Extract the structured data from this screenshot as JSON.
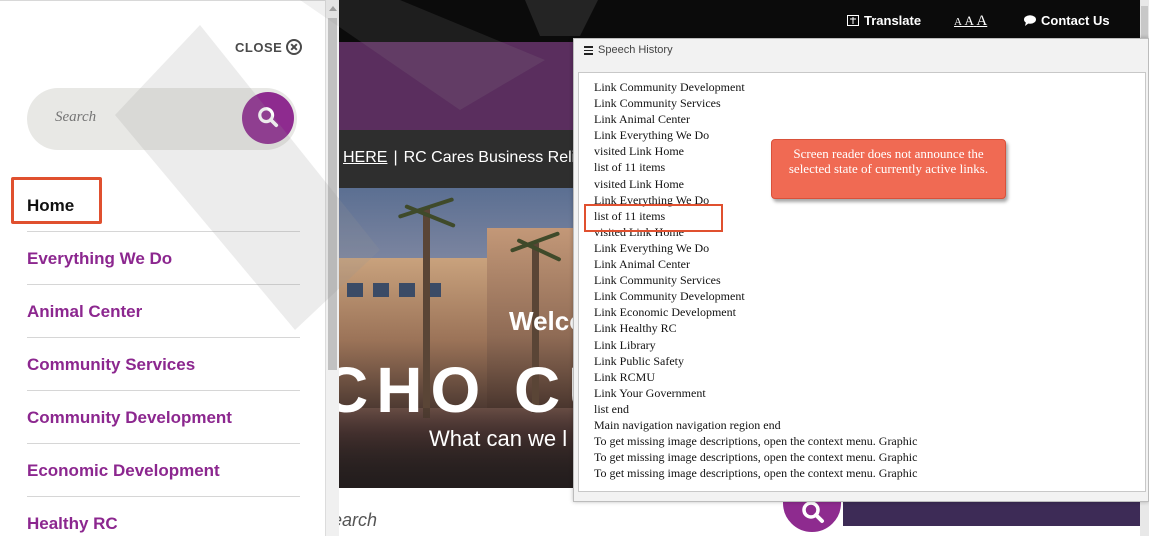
{
  "topbar": {
    "translate_label": "Translate",
    "text_size_small": "A",
    "text_size_medium": "A",
    "text_size_large": "A",
    "contact_label": "Contact Us"
  },
  "notice_bar": {
    "link_text": "HERE",
    "separator": "|",
    "text": "RC Cares Business Relie"
  },
  "hero": {
    "welcome": "Welco",
    "big_text": "CHO CU",
    "subtitle": "What can we l"
  },
  "bottom": {
    "search_placeholder": "earch"
  },
  "sidebar": {
    "close_label": "CLOSE",
    "search_placeholder": "Search",
    "items": [
      {
        "label": "Home"
      },
      {
        "label": "Everything We Do"
      },
      {
        "label": "Animal Center"
      },
      {
        "label": "Community Services"
      },
      {
        "label": "Community Development"
      },
      {
        "label": "Economic Development"
      },
      {
        "label": "Healthy RC"
      }
    ]
  },
  "speech_history": {
    "title": "Speech History",
    "lines": [
      "Link Community Development",
      "Link Community Services",
      "Link Animal Center",
      "Link Everything We Do",
      "visited Link Home",
      "list of 11 items",
      "visited Link Home",
      "Link Everything We Do",
      "list of 11 items",
      "visited Link Home",
      "Link Everything We Do",
      "Link Animal Center",
      "Link Community Services",
      "Link Community Development",
      "Link Economic Development",
      "Link Healthy RC",
      "Link Library",
      "Link Public Safety",
      "Link RCMU",
      "Link Your Government",
      "list end",
      "Main navigation navigation region end",
      "To get missing image descriptions, open the context menu. Graphic",
      "To get missing image descriptions, open the context menu. Graphic",
      "To get missing image descriptions, open the context menu. Graphic"
    ]
  },
  "annotation": {
    "callout_text": "Screen reader does not announce the selected state of currently active links.",
    "highlight_color": "#e0502f",
    "callout_color": "#f06a53"
  },
  "colors": {
    "brand_purple": "#8c278f",
    "topbar_bg": "#0b0b0b"
  }
}
